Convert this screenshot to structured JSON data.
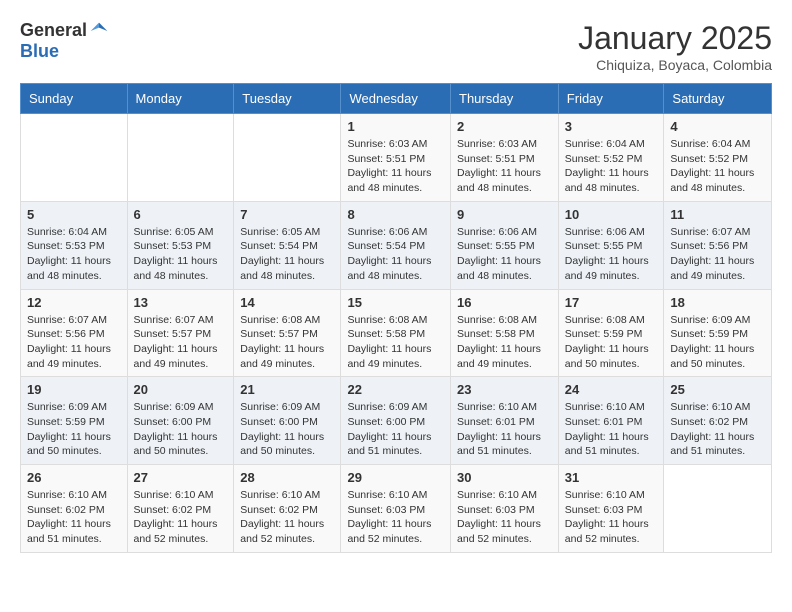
{
  "header": {
    "logo_general": "General",
    "logo_blue": "Blue",
    "title": "January 2025",
    "subtitle": "Chiquiza, Boyaca, Colombia"
  },
  "days_of_week": [
    "Sunday",
    "Monday",
    "Tuesday",
    "Wednesday",
    "Thursday",
    "Friday",
    "Saturday"
  ],
  "weeks": [
    [
      {
        "day": "",
        "info": ""
      },
      {
        "day": "",
        "info": ""
      },
      {
        "day": "",
        "info": ""
      },
      {
        "day": "1",
        "info": "Sunrise: 6:03 AM\nSunset: 5:51 PM\nDaylight: 11 hours and 48 minutes."
      },
      {
        "day": "2",
        "info": "Sunrise: 6:03 AM\nSunset: 5:51 PM\nDaylight: 11 hours and 48 minutes."
      },
      {
        "day": "3",
        "info": "Sunrise: 6:04 AM\nSunset: 5:52 PM\nDaylight: 11 hours and 48 minutes."
      },
      {
        "day": "4",
        "info": "Sunrise: 6:04 AM\nSunset: 5:52 PM\nDaylight: 11 hours and 48 minutes."
      }
    ],
    [
      {
        "day": "5",
        "info": "Sunrise: 6:04 AM\nSunset: 5:53 PM\nDaylight: 11 hours and 48 minutes."
      },
      {
        "day": "6",
        "info": "Sunrise: 6:05 AM\nSunset: 5:53 PM\nDaylight: 11 hours and 48 minutes."
      },
      {
        "day": "7",
        "info": "Sunrise: 6:05 AM\nSunset: 5:54 PM\nDaylight: 11 hours and 48 minutes."
      },
      {
        "day": "8",
        "info": "Sunrise: 6:06 AM\nSunset: 5:54 PM\nDaylight: 11 hours and 48 minutes."
      },
      {
        "day": "9",
        "info": "Sunrise: 6:06 AM\nSunset: 5:55 PM\nDaylight: 11 hours and 48 minutes."
      },
      {
        "day": "10",
        "info": "Sunrise: 6:06 AM\nSunset: 5:55 PM\nDaylight: 11 hours and 49 minutes."
      },
      {
        "day": "11",
        "info": "Sunrise: 6:07 AM\nSunset: 5:56 PM\nDaylight: 11 hours and 49 minutes."
      }
    ],
    [
      {
        "day": "12",
        "info": "Sunrise: 6:07 AM\nSunset: 5:56 PM\nDaylight: 11 hours and 49 minutes."
      },
      {
        "day": "13",
        "info": "Sunrise: 6:07 AM\nSunset: 5:57 PM\nDaylight: 11 hours and 49 minutes."
      },
      {
        "day": "14",
        "info": "Sunrise: 6:08 AM\nSunset: 5:57 PM\nDaylight: 11 hours and 49 minutes."
      },
      {
        "day": "15",
        "info": "Sunrise: 6:08 AM\nSunset: 5:58 PM\nDaylight: 11 hours and 49 minutes."
      },
      {
        "day": "16",
        "info": "Sunrise: 6:08 AM\nSunset: 5:58 PM\nDaylight: 11 hours and 49 minutes."
      },
      {
        "day": "17",
        "info": "Sunrise: 6:08 AM\nSunset: 5:59 PM\nDaylight: 11 hours and 50 minutes."
      },
      {
        "day": "18",
        "info": "Sunrise: 6:09 AM\nSunset: 5:59 PM\nDaylight: 11 hours and 50 minutes."
      }
    ],
    [
      {
        "day": "19",
        "info": "Sunrise: 6:09 AM\nSunset: 5:59 PM\nDaylight: 11 hours and 50 minutes."
      },
      {
        "day": "20",
        "info": "Sunrise: 6:09 AM\nSunset: 6:00 PM\nDaylight: 11 hours and 50 minutes."
      },
      {
        "day": "21",
        "info": "Sunrise: 6:09 AM\nSunset: 6:00 PM\nDaylight: 11 hours and 50 minutes."
      },
      {
        "day": "22",
        "info": "Sunrise: 6:09 AM\nSunset: 6:00 PM\nDaylight: 11 hours and 51 minutes."
      },
      {
        "day": "23",
        "info": "Sunrise: 6:10 AM\nSunset: 6:01 PM\nDaylight: 11 hours and 51 minutes."
      },
      {
        "day": "24",
        "info": "Sunrise: 6:10 AM\nSunset: 6:01 PM\nDaylight: 11 hours and 51 minutes."
      },
      {
        "day": "25",
        "info": "Sunrise: 6:10 AM\nSunset: 6:02 PM\nDaylight: 11 hours and 51 minutes."
      }
    ],
    [
      {
        "day": "26",
        "info": "Sunrise: 6:10 AM\nSunset: 6:02 PM\nDaylight: 11 hours and 51 minutes."
      },
      {
        "day": "27",
        "info": "Sunrise: 6:10 AM\nSunset: 6:02 PM\nDaylight: 11 hours and 52 minutes."
      },
      {
        "day": "28",
        "info": "Sunrise: 6:10 AM\nSunset: 6:02 PM\nDaylight: 11 hours and 52 minutes."
      },
      {
        "day": "29",
        "info": "Sunrise: 6:10 AM\nSunset: 6:03 PM\nDaylight: 11 hours and 52 minutes."
      },
      {
        "day": "30",
        "info": "Sunrise: 6:10 AM\nSunset: 6:03 PM\nDaylight: 11 hours and 52 minutes."
      },
      {
        "day": "31",
        "info": "Sunrise: 6:10 AM\nSunset: 6:03 PM\nDaylight: 11 hours and 52 minutes."
      },
      {
        "day": "",
        "info": ""
      }
    ]
  ]
}
